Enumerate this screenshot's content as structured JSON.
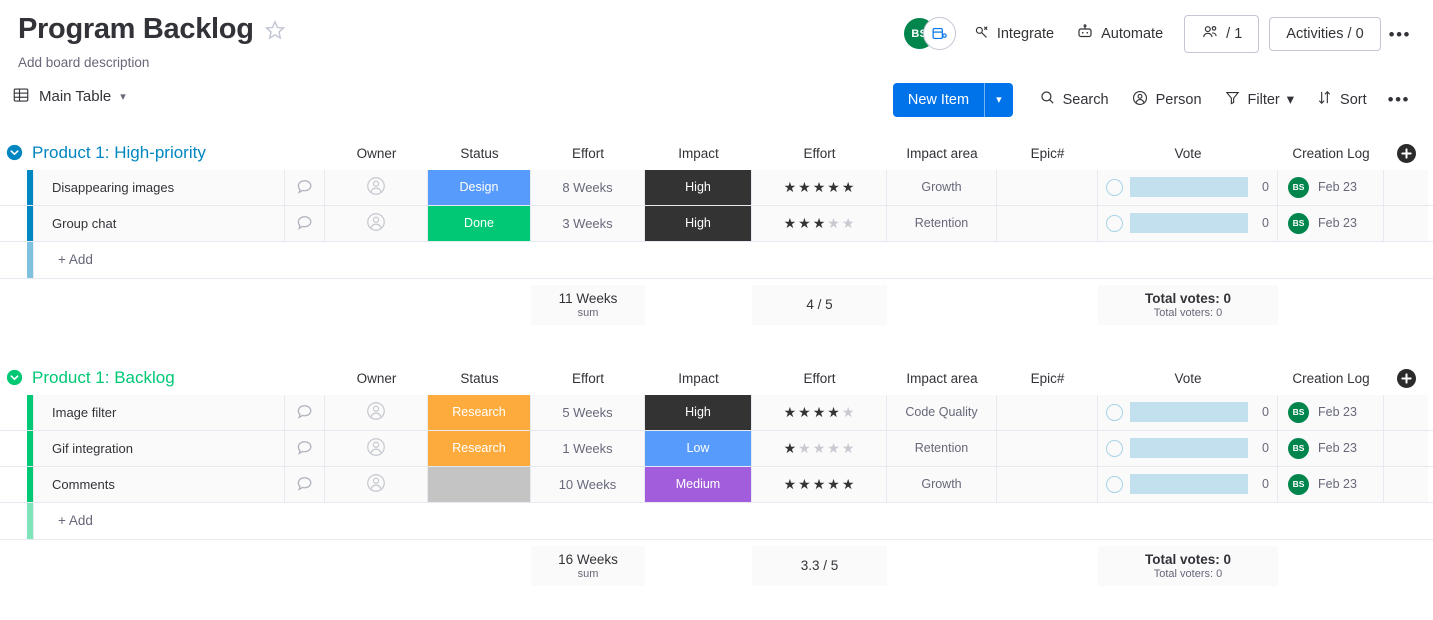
{
  "header": {
    "title": "Program Backlog",
    "description": "Add board description",
    "star_icon": "star-outline-icon",
    "avatar_initials": "BS",
    "view_badge_icon": "board-view-icon",
    "integrate_label": "Integrate",
    "integrate_icon": "integrate-icon",
    "automate_label": "Automate",
    "automate_icon": "robot-icon",
    "members_label": "/ 1",
    "members_icon": "people-icon",
    "activities_label": "Activities / 0",
    "more_icon": "more-options-icon"
  },
  "toolbar": {
    "view_name": "Main Table",
    "view_icon": "table-icon",
    "view_caret": "chevron-down-icon",
    "new_item_label": "New Item",
    "new_item_caret": "chevron-down-icon",
    "search_label": "Search",
    "search_icon": "search-icon",
    "person_label": "Person",
    "person_icon": "person-icon",
    "filter_label": "Filter",
    "filter_icon": "funnel-icon",
    "filter_caret": "chevron-down-icon",
    "sort_label": "Sort",
    "sort_icon": "sort-icon",
    "more_icon": "more-options-icon"
  },
  "columns": [
    {
      "label": "Owner"
    },
    {
      "label": "Status"
    },
    {
      "label": "Effort"
    },
    {
      "label": "Impact"
    },
    {
      "label": "Effort"
    },
    {
      "label": "Impact area"
    },
    {
      "label": "Epic#"
    },
    {
      "label": "Vote"
    },
    {
      "label": "Creation Log"
    }
  ],
  "add_column_icon": "add-column-icon",
  "add_row_label": "+ Add",
  "colors": {
    "group_high_priority": "#0086c0",
    "group_backlog": "#00c875",
    "status_design": "#579bfc",
    "status_done": "#00c875",
    "status_research": "#fdab3d",
    "status_empty": "#c4c4c4",
    "impact_high": "#333333",
    "impact_low": "#579bfc",
    "impact_medium": "#a25ddc",
    "primary_blue": "#0073ea",
    "avatar_green": "#00854d",
    "vote_bar": "#c3e0ef"
  },
  "groups": [
    {
      "name": "Product 1: High-priority",
      "color": "#0086c0",
      "bar_color": "#0086c0",
      "add_bar_color": "#7fc2df",
      "toggle_icon": "chevron-down-circle-icon",
      "rows": [
        {
          "name": "Disappearing images",
          "chat_icon": "comment-bubble-icon",
          "owner_icon": "person-placeholder-icon",
          "status": "Design",
          "status_color": "#579bfc",
          "effort": "8 Weeks",
          "impact": "High",
          "impact_color": "#333333",
          "rating": 5,
          "rating_max": 5,
          "impact_area": "Growth",
          "epic": "",
          "vote_count": "0",
          "log_initials": "BS",
          "log_date": "Feb 23"
        },
        {
          "name": "Group chat",
          "chat_icon": "comment-bubble-icon",
          "owner_icon": "person-placeholder-icon",
          "status": "Done",
          "status_color": "#00c875",
          "effort": "3 Weeks",
          "impact": "High",
          "impact_color": "#333333",
          "rating": 3,
          "rating_max": 5,
          "impact_area": "Retention",
          "epic": "",
          "vote_count": "0",
          "log_initials": "BS",
          "log_date": "Feb 23"
        }
      ],
      "summary": {
        "effort_total": "11 Weeks",
        "effort_label": "sum",
        "rating_avg": "4 / 5",
        "votes_total": "Total votes: 0",
        "voters_total": "Total voters: 0"
      }
    },
    {
      "name": "Product 1: Backlog",
      "color": "#00c875",
      "bar_color": "#00c875",
      "add_bar_color": "#80e4ba",
      "toggle_icon": "chevron-down-circle-icon",
      "rows": [
        {
          "name": "Image filter",
          "chat_icon": "comment-bubble-icon",
          "owner_icon": "person-placeholder-icon",
          "status": "Research",
          "status_color": "#fdab3d",
          "effort": "5 Weeks",
          "impact": "High",
          "impact_color": "#333333",
          "rating": 4,
          "rating_max": 5,
          "impact_area": "Code Quality",
          "epic": "",
          "vote_count": "0",
          "log_initials": "BS",
          "log_date": "Feb 23"
        },
        {
          "name": "Gif integration",
          "chat_icon": "comment-bubble-icon",
          "owner_icon": "person-placeholder-icon",
          "status": "Research",
          "status_color": "#fdab3d",
          "effort": "1 Weeks",
          "impact": "Low",
          "impact_color": "#579bfc",
          "rating": 1,
          "rating_max": 5,
          "impact_area": "Retention",
          "epic": "",
          "vote_count": "0",
          "log_initials": "BS",
          "log_date": "Feb 23"
        },
        {
          "name": "Comments",
          "chat_icon": "comment-bubble-icon",
          "owner_icon": "person-placeholder-icon",
          "status": "",
          "status_color": "#c4c4c4",
          "effort": "10 Weeks",
          "impact": "Medium",
          "impact_color": "#a25ddc",
          "rating": 5,
          "rating_max": 5,
          "impact_area": "Growth",
          "epic": "",
          "vote_count": "0",
          "log_initials": "BS",
          "log_date": "Feb 23"
        }
      ],
      "summary": {
        "effort_total": "16 Weeks",
        "effort_label": "sum",
        "rating_avg": "3.3 / 5",
        "votes_total": "Total votes: 0",
        "voters_total": "Total voters: 0"
      }
    }
  ]
}
